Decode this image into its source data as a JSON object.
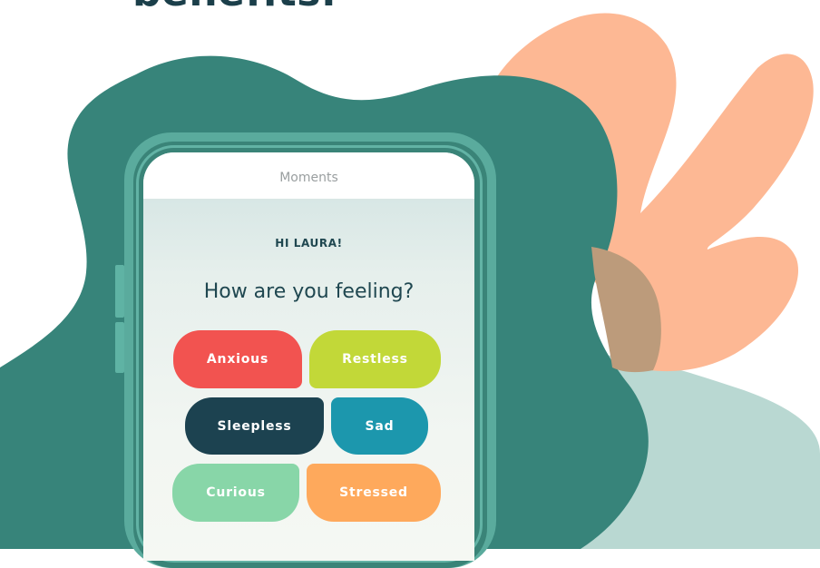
{
  "heading_fragment": "benefits.",
  "phone": {
    "app_title": "Moments",
    "greeting": "HI LAURA!",
    "question": "How are you feeling?",
    "moods": [
      {
        "label": "Anxious",
        "color": "#f25350"
      },
      {
        "label": "Restless",
        "color": "#c2d838"
      },
      {
        "label": "Sleepless",
        "color": "#1c4250"
      },
      {
        "label": "Sad",
        "color": "#1c97ad"
      },
      {
        "label": "Curious",
        "color": "#88d6a8"
      },
      {
        "label": "Stressed",
        "color": "#fea95c"
      }
    ]
  },
  "colors": {
    "dark_teal_blob": "#37847a",
    "peach_leaf": "#fdb894",
    "light_teal_blob": "#b9d8d2",
    "overlap_brown": "#bc9b7b",
    "heading": "#1b3f4a"
  }
}
